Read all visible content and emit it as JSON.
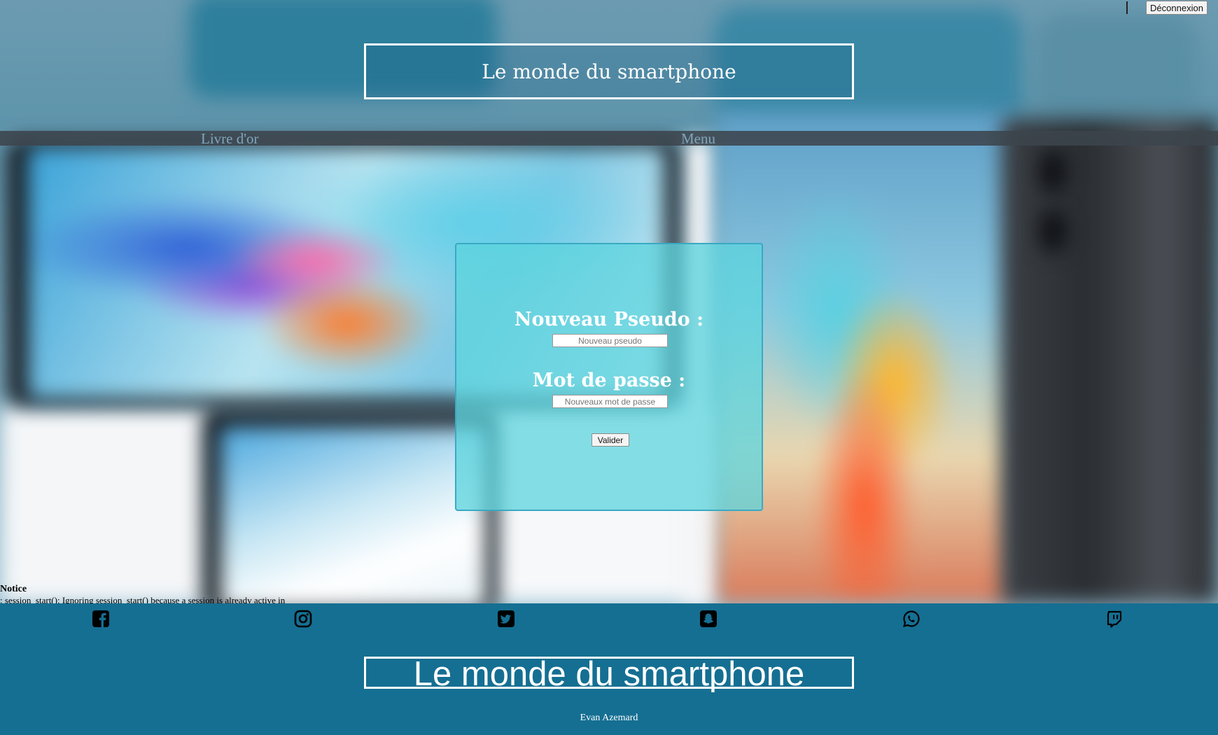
{
  "header": {
    "title": "Le monde du smartphone",
    "logout_label": "Déconnexion"
  },
  "nav": {
    "guestbook": "Livre d'or",
    "menu": "Menu"
  },
  "form": {
    "pseudo_label": "Nouveau Pseudo :",
    "pseudo_placeholder": "Nouveau pseudo",
    "password_label": "Mot de passe :",
    "password_placeholder": "Nouveaux mot de passe",
    "submit_label": "Valider"
  },
  "notice": {
    "title": "Notice",
    "message": ": session_start(): Ignoring session_start() because a session is already active in"
  },
  "footer": {
    "social_icons": [
      "facebook-icon",
      "instagram-icon",
      "twitter-icon",
      "snapchat-icon",
      "whatsapp-icon",
      "twitch-icon"
    ],
    "title": "Le monde du smartphone",
    "author": "Evan Azemard"
  },
  "colors": {
    "footer_bg": "#156f92",
    "card_border": "#3aa9c3",
    "nav_link": "#7fa6bd"
  }
}
